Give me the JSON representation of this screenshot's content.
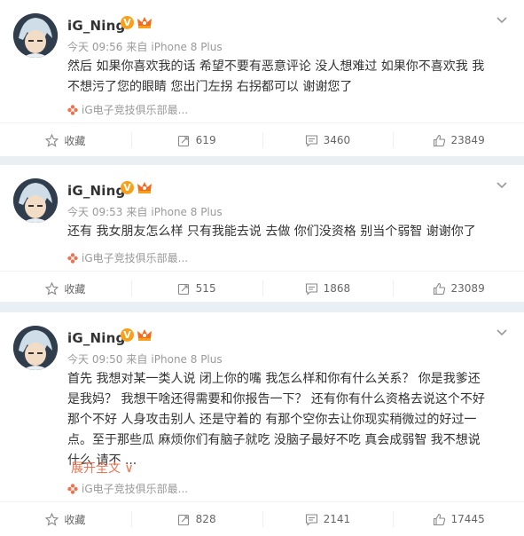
{
  "posts": [
    {
      "user": "iG_Ning",
      "time": "今天 09:56",
      "via": "来自",
      "device": "iPhone 8 Plus",
      "text": "然后 如果你喜欢我的话 希望不要有恶意评论 没人想难过 如果你不喜欢我 我不想污了您的眼睛 您出门左拐 右拐都可以 谢谢您了",
      "source": "iG电子竞技俱乐部最...",
      "expand": "",
      "actions": {
        "favorite": "收藏",
        "repost": "619",
        "comment": "3460",
        "like": "23849"
      }
    },
    {
      "user": "iG_Ning",
      "time": "今天 09:53",
      "via": "来自",
      "device": "iPhone 8 Plus",
      "text": "还有 我女朋友怎么样 只有我能去说 去做 你们没资格 别当个弱智 谢谢你了",
      "source": "iG电子竞技俱乐部最...",
      "expand": "",
      "actions": {
        "favorite": "收藏",
        "repost": "515",
        "comment": "1868",
        "like": "23089"
      }
    },
    {
      "user": "iG_Ning",
      "time": "今天 09:50",
      "via": "来自",
      "device": "iPhone 8 Plus",
      "text": "首先 我想对某一类人说 闭上你的嘴 我怎么样和你有什么关系？ 你是我爹还是我妈？ 我想干啥还得需要和你报告一下？ 还有你有什么资格去说这个不好那个不好 人身攻击别人 还是守着的 有那个空你去让你现实稍微过的好过一点。至于那些瓜 麻烦你们有脑子就吃 没脑子最好不吃 真会成弱智 我不想说什么 请不 ...",
      "source": "iG电子竞技俱乐部最...",
      "expand": "展开全文 ∨",
      "actions": {
        "favorite": "收藏",
        "repost": "828",
        "comment": "2141",
        "like": "17445"
      }
    }
  ],
  "icons": {
    "verified": "V",
    "crown": "crown-icon",
    "chevron": "chevron-down-icon",
    "star": "star-icon",
    "repost": "repost-icon",
    "comment": "comment-icon",
    "like": "thumbs-up-icon",
    "flower": "flower-icon"
  },
  "colors": {
    "accent": "#eb7350",
    "badge": "#f9a01b",
    "separator": "#e9eff3"
  }
}
